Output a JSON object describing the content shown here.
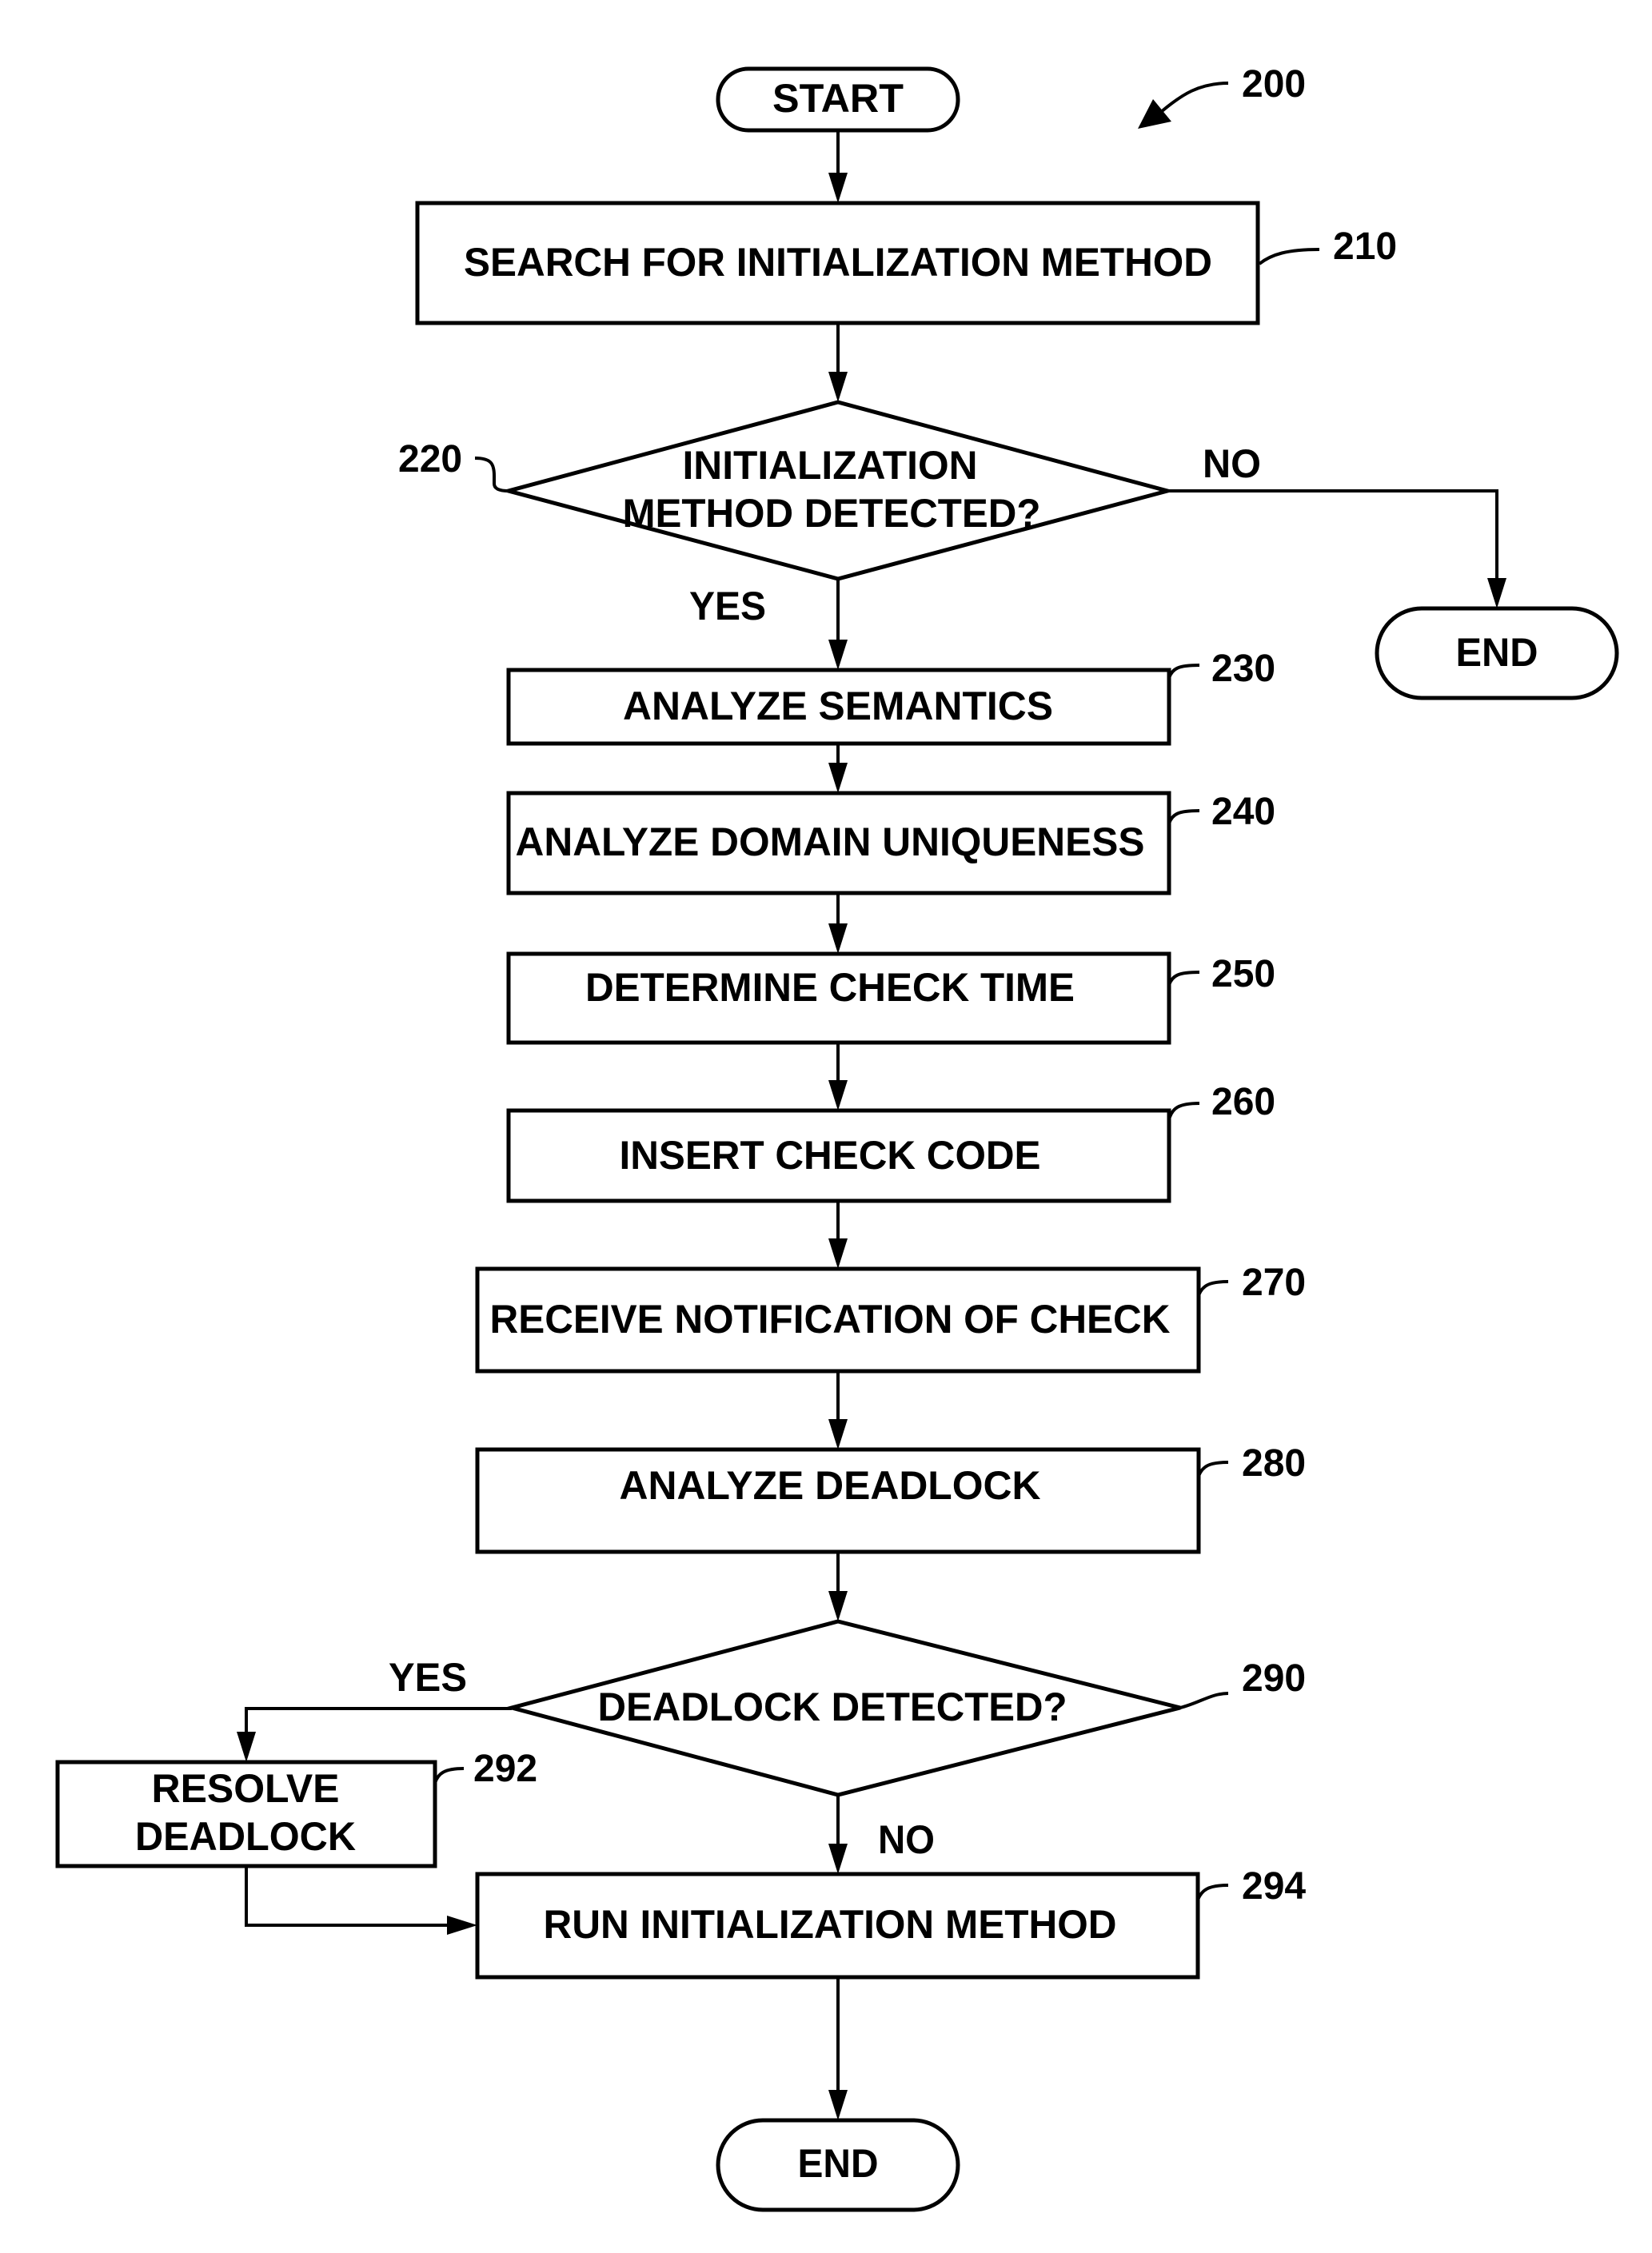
{
  "figure": {
    "reference": "200",
    "start_label": "START",
    "end_label": "END"
  },
  "steps": {
    "s210": {
      "ref": "210",
      "text": "SEARCH FOR INITIALIZATION METHOD"
    },
    "s220": {
      "ref": "220",
      "line1": "INITIALIZATION",
      "line2": "METHOD DETECTED?",
      "yes": "YES",
      "no": "NO"
    },
    "s230": {
      "ref": "230",
      "text": "ANALYZE SEMANTICS"
    },
    "s240": {
      "ref": "240",
      "text": "ANALYZE DOMAIN UNIQUENESS"
    },
    "s250": {
      "ref": "250",
      "text": "DETERMINE CHECK TIME"
    },
    "s260": {
      "ref": "260",
      "text": "INSERT CHECK CODE"
    },
    "s270": {
      "ref": "270",
      "text": "RECEIVE NOTIFICATION OF CHECK"
    },
    "s280": {
      "ref": "280",
      "text": "ANALYZE DEADLOCK"
    },
    "s290": {
      "ref": "290",
      "text": "DEADLOCK DETECTED?",
      "yes": "YES",
      "no": "NO"
    },
    "s292": {
      "ref": "292",
      "line1": "RESOLVE",
      "line2": "DEADLOCK"
    },
    "s294": {
      "ref": "294",
      "text": "RUN INITIALIZATION METHOD"
    }
  },
  "terminals": {
    "end_no_init": "END",
    "end_final": "END"
  }
}
